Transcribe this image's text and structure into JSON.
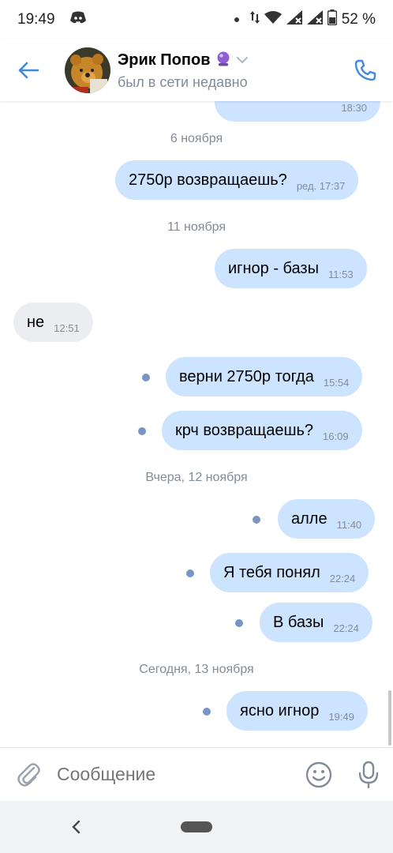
{
  "status_bar": {
    "time": "19:49",
    "battery": "52 %"
  },
  "header": {
    "name": "Эрик Попов",
    "last_seen": "был в сети недавно"
  },
  "partial_message_time": "18:30",
  "messages": [
    {
      "type": "date",
      "text": "6 ноября"
    },
    {
      "type": "out",
      "text": "2750р возвращаешь?",
      "time": "ред. 17:37"
    },
    {
      "type": "date",
      "text": "11 ноября"
    },
    {
      "type": "out",
      "text": "игнор - базы",
      "time": "11:53"
    },
    {
      "type": "in",
      "text": "не",
      "time": "12:51"
    },
    {
      "type": "out",
      "text": "верни 2750р тогда",
      "time": "15:54",
      "unread": true
    },
    {
      "type": "out",
      "text": "крч возвращаешь?",
      "time": "16:09",
      "unread": true
    },
    {
      "type": "date",
      "text": "Вчера, 12 ноября"
    },
    {
      "type": "out",
      "text": "алле",
      "time": "11:40",
      "unread": true
    },
    {
      "type": "out",
      "text": "Я тебя понял",
      "time": "22:24",
      "unread": true
    },
    {
      "type": "out",
      "text": "В базы",
      "time": "22:24",
      "unread": true
    },
    {
      "type": "date",
      "text": "Сегодня, 13 ноября"
    },
    {
      "type": "out",
      "text": "ясно игнор",
      "time": "19:49",
      "unread": true
    }
  ],
  "composer": {
    "placeholder": "Сообщение"
  },
  "colors": {
    "accent": "#3f8ae0",
    "outgoing_bubble": "#cce4ff",
    "incoming_bubble": "#ebedf0",
    "unread_dot": "#7895c5",
    "secondary_text": "#818c99"
  }
}
